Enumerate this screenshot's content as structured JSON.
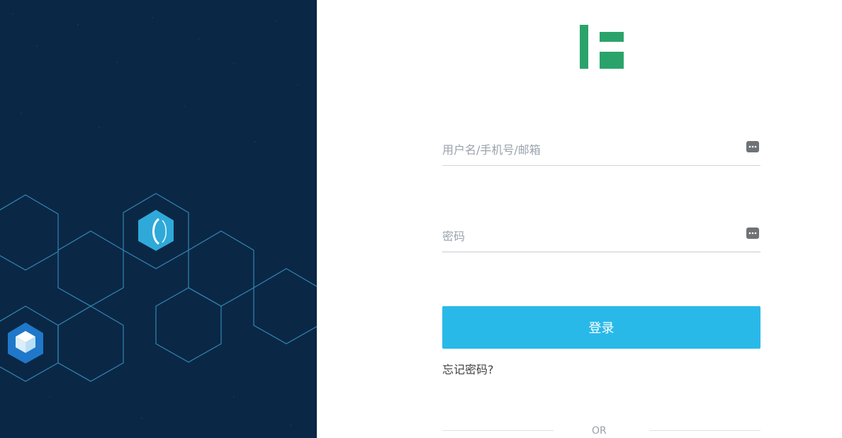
{
  "login": {
    "username_placeholder": "用户名/手机号/邮箱",
    "password_placeholder": "密码",
    "login_button_label": "登录",
    "forgot_password_label": "忘记密码?",
    "divider_label": "OR"
  },
  "colors": {
    "left_panel_background": "#0b2746",
    "login_button": "#29b9e9",
    "logo_green": "#2aa36b"
  },
  "icons": {
    "username_field_icon": "password-dots-icon",
    "password_field_icon": "password-dots-icon",
    "logo": "brand-logo",
    "left_panel_icons": [
      "circle-shape-icon",
      "cube-icon"
    ]
  }
}
